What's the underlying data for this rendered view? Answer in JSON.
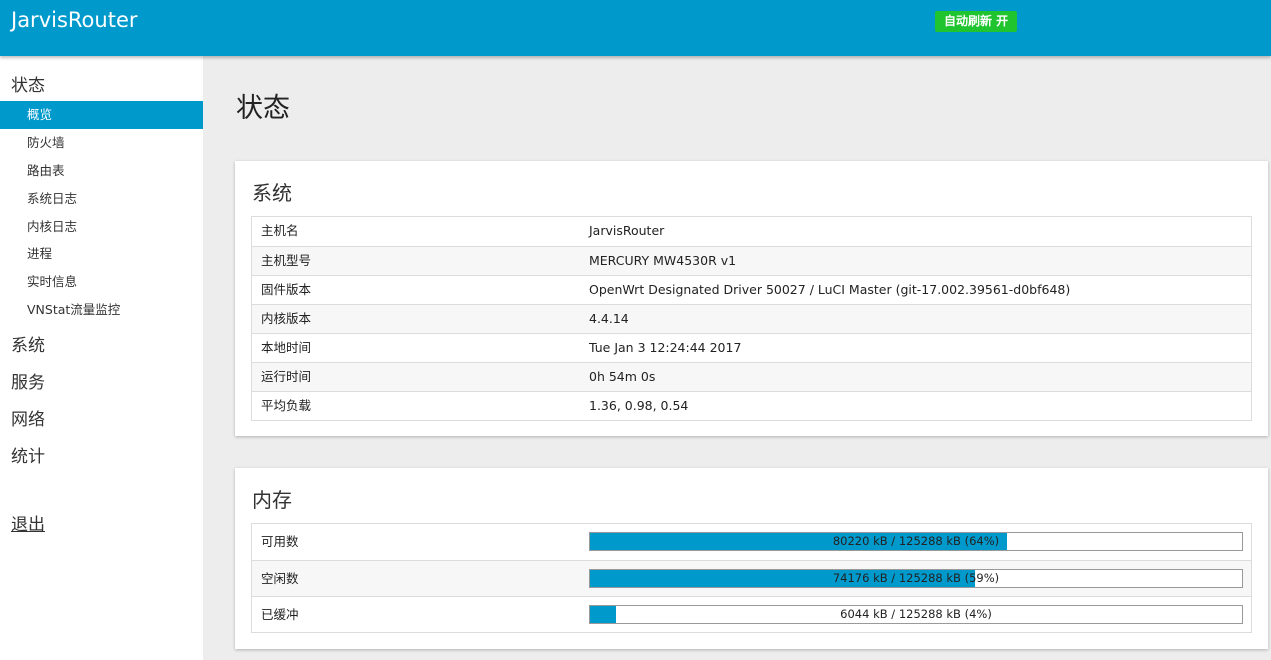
{
  "header": {
    "brand": "JarvisRouter",
    "auto_refresh": "自动刷新 开"
  },
  "sidebar": {
    "categories": [
      "状态",
      "系统",
      "服务",
      "网络",
      "统计"
    ],
    "status_items": [
      "概览",
      "防火墙",
      "路由表",
      "系统日志",
      "内核日志",
      "进程",
      "实时信息",
      "VNStat流量监控"
    ],
    "active_item": "概览",
    "logout": "退出"
  },
  "page": {
    "title": "状态"
  },
  "system": {
    "title": "系统",
    "rows": [
      {
        "key": "主机名",
        "value": "JarvisRouter"
      },
      {
        "key": "主机型号",
        "value": "MERCURY MW4530R v1"
      },
      {
        "key": "固件版本",
        "value": "OpenWrt Designated Driver 50027 / LuCI Master (git-17.002.39561-d0bf648)"
      },
      {
        "key": "内核版本",
        "value": "4.4.14"
      },
      {
        "key": "本地时间",
        "value": "Tue Jan 3 12:24:44 2017"
      },
      {
        "key": "运行时间",
        "value": "0h 54m 0s"
      },
      {
        "key": "平均负载",
        "value": "1.36, 0.98, 0.54"
      }
    ]
  },
  "memory": {
    "title": "内存",
    "rows": [
      {
        "key": "可用数",
        "text": "80220 kB / 125288 kB (64%)",
        "percent": 64
      },
      {
        "key": "空闲数",
        "text": "74176 kB / 125288 kB (59%)",
        "percent": 59
      },
      {
        "key": "已缓冲",
        "text": "6044 kB / 125288 kB (4%)",
        "percent": 4
      }
    ]
  },
  "colors": {
    "accent": "#0099cc",
    "refresh_badge": "#1fc42f",
    "background": "#ededed"
  }
}
